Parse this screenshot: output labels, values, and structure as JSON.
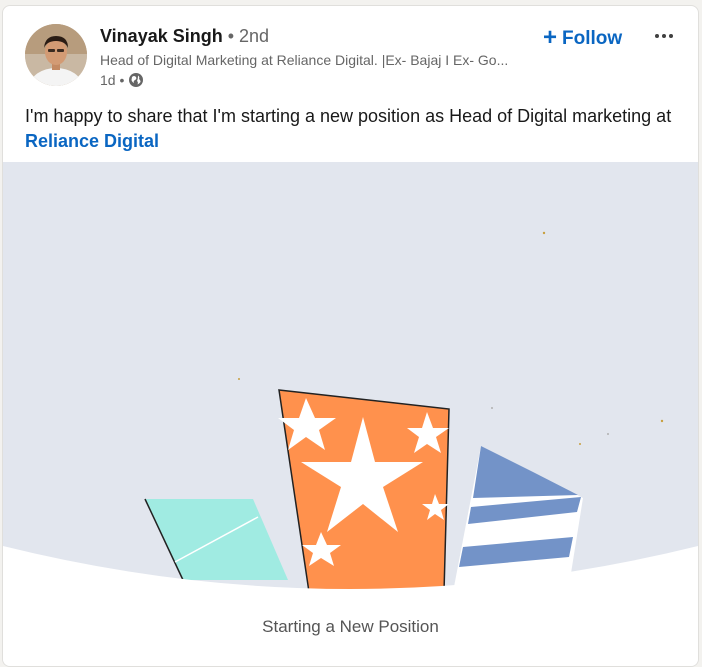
{
  "author": {
    "name": "Vinayak Singh",
    "degree": "• 2nd",
    "headline": "Head of Digital Marketing at Reliance Digital. |Ex- Bajaj I Ex- Go...",
    "time": "1d •",
    "visibility_icon": "globe-icon"
  },
  "actions": {
    "follow_label": "Follow",
    "follow_icon": "plus-icon",
    "more_icon": "ellipsis-icon"
  },
  "post": {
    "text": "I'm happy to share that I'm starting a new position as Head of Digital marketing at ",
    "company_link": "Reliance Digital"
  },
  "celebration": {
    "caption": "Starting a New Position"
  },
  "colors": {
    "accent": "#0a66c2",
    "image_bg": "#e2e6ee",
    "orange": "#ff914d",
    "teal": "#a0ebe2",
    "blue": "#7393c8"
  }
}
